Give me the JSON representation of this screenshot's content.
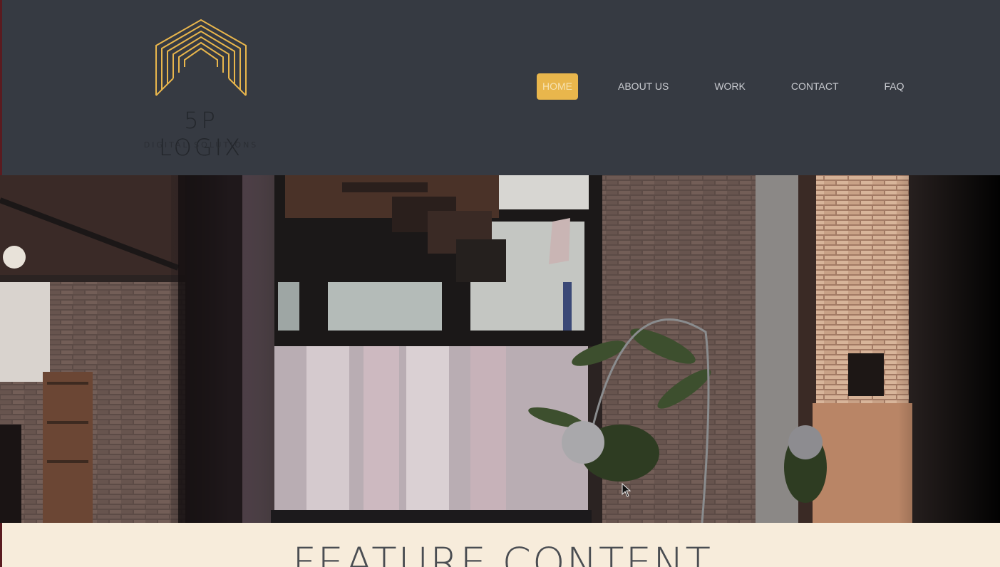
{
  "brand": {
    "name": "5P LOGIX",
    "tagline": "DIGITAL SOLUTIONS",
    "accent_color": "#e9b64c"
  },
  "nav": {
    "items": [
      {
        "label": "HOME",
        "active": true
      },
      {
        "label": "ABOUT US",
        "active": false
      },
      {
        "label": "WORK",
        "active": false
      },
      {
        "label": "CONTACT",
        "active": false
      },
      {
        "label": "FAQ",
        "active": false
      }
    ]
  },
  "hero": {
    "image": "loft-interior-photo"
  },
  "feature": {
    "title": "FEATURE CONTENT"
  }
}
